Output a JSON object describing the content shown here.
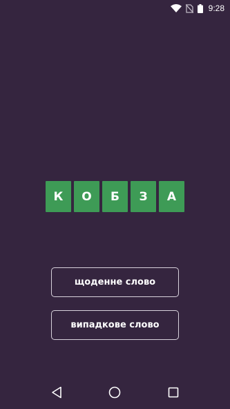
{
  "status_bar": {
    "time": "9:28",
    "icons": [
      "wifi-icon",
      "no-sim-icon",
      "battery-icon"
    ]
  },
  "word": {
    "letters": [
      "К",
      "О",
      "Б",
      "З",
      "А"
    ],
    "tile_color": "#3e9b56"
  },
  "buttons": {
    "daily": "щоденне слово",
    "random": "випадкове слово"
  },
  "nav_bar": {
    "icons": [
      "back-icon",
      "home-icon",
      "recents-icon"
    ]
  },
  "colors": {
    "background": "#35253f",
    "tile": "#3e9b56",
    "button_border": "#d9d3dd"
  }
}
